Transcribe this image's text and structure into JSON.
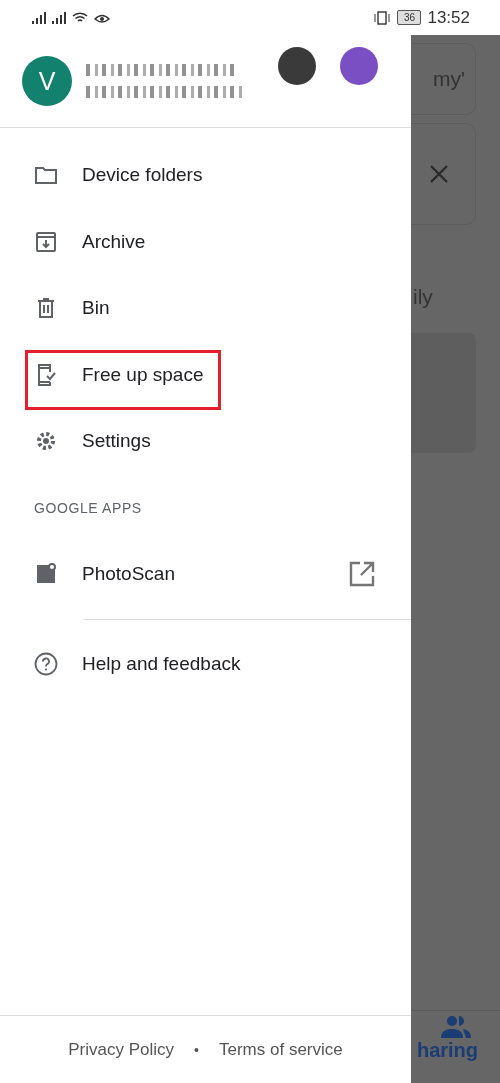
{
  "status_bar": {
    "battery": "36",
    "time": "13:52"
  },
  "account": {
    "initial": "V"
  },
  "menu": [
    {
      "label": "Device folders",
      "highlighted": false
    },
    {
      "label": "Archive",
      "highlighted": false
    },
    {
      "label": "Bin",
      "highlighted": false
    },
    {
      "label": "Free up space",
      "highlighted": true
    },
    {
      "label": "Settings",
      "highlighted": false
    }
  ],
  "section_title": "GOOGLE APPS",
  "apps": [
    {
      "label": "PhotoScan"
    }
  ],
  "help": {
    "label": "Help and feedback"
  },
  "footer": {
    "links": [
      "Privacy Policy",
      "Terms of service"
    ],
    "separator": "•"
  },
  "background": {
    "card_text": "my'",
    "heading_text": "ily",
    "nav_label": "haring"
  }
}
